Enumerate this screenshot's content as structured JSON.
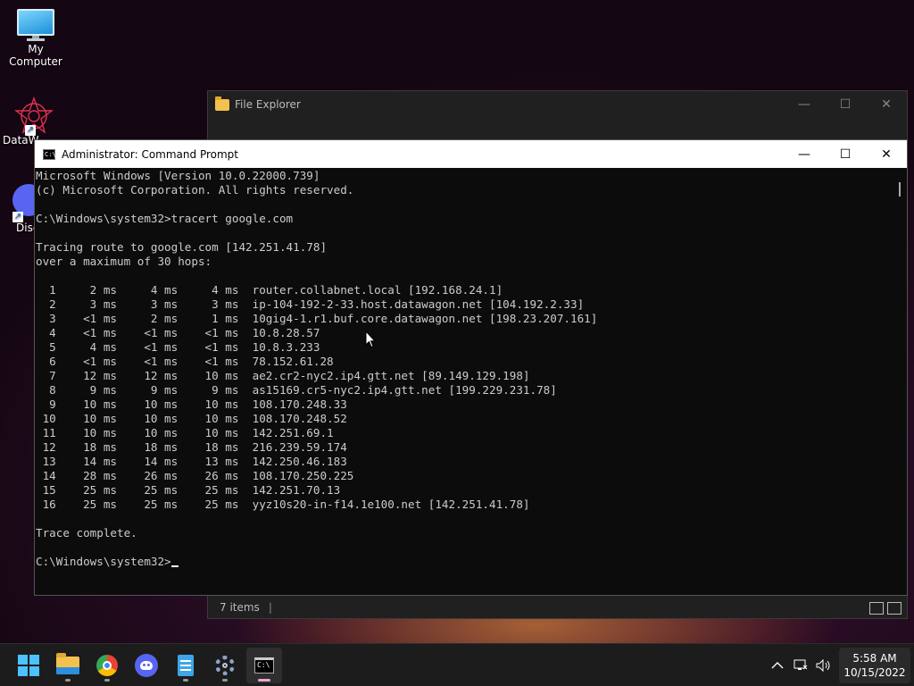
{
  "desktop": {
    "icons": [
      {
        "label": "My Computer"
      },
      {
        "label": "DataW"
      },
      {
        "label": "Disc"
      }
    ]
  },
  "explorer": {
    "title": "File Explorer",
    "status_items": "7 items",
    "status_sep": "|"
  },
  "cmd": {
    "title": "Administrator: Command Prompt",
    "lines": [
      "Microsoft Windows [Version 10.0.22000.739]",
      "(c) Microsoft Corporation. All rights reserved.",
      "",
      "C:\\Windows\\system32>tracert google.com",
      "",
      "Tracing route to google.com [142.251.41.78]",
      "over a maximum of 30 hops:",
      "",
      "  1     2 ms     4 ms     4 ms  router.collabnet.local [192.168.24.1]",
      "  2     3 ms     3 ms     3 ms  ip-104-192-2-33.host.datawagon.net [104.192.2.33]",
      "  3    <1 ms     2 ms     1 ms  10gig4-1.r1.buf.core.datawagon.net [198.23.207.161]",
      "  4    <1 ms    <1 ms    <1 ms  10.8.28.57",
      "  5     4 ms    <1 ms    <1 ms  10.8.3.233",
      "  6    <1 ms    <1 ms    <1 ms  78.152.61.28",
      "  7    12 ms    12 ms    10 ms  ae2.cr2-nyc2.ip4.gtt.net [89.149.129.198]",
      "  8     9 ms     9 ms     9 ms  as15169.cr5-nyc2.ip4.gtt.net [199.229.231.78]",
      "  9    10 ms    10 ms    10 ms  108.170.248.33",
      " 10    10 ms    10 ms    10 ms  108.170.248.52",
      " 11    10 ms    10 ms    10 ms  142.251.69.1",
      " 12    18 ms    18 ms    18 ms  216.239.59.174",
      " 13    14 ms    14 ms    13 ms  142.250.46.183",
      " 14    28 ms    26 ms    26 ms  108.170.250.225",
      " 15    25 ms    25 ms    25 ms  142.251.70.13",
      " 16    25 ms    25 ms    25 ms  yyz10s20-in-f14.1e100.net [142.251.41.78]",
      "",
      "Trace complete.",
      ""
    ],
    "prompt": "C:\\Windows\\system32>"
  },
  "taskbar": {
    "apps": [
      {
        "name": "start",
        "icon": "windows-logo-icon"
      },
      {
        "name": "file-explorer",
        "icon": "folder-icon"
      },
      {
        "name": "chrome",
        "icon": "chrome-icon"
      },
      {
        "name": "discord",
        "icon": "discord-icon"
      },
      {
        "name": "notepad",
        "icon": "notepad-icon"
      },
      {
        "name": "settings",
        "icon": "gear-icon"
      },
      {
        "name": "command-prompt",
        "icon": "terminal-icon"
      }
    ],
    "time": "5:58 AM",
    "date": "10/15/2022"
  },
  "colors": {
    "accent": "#4cc2ff",
    "console_bg": "#0c0c0c",
    "console_fg": "#cccccc"
  }
}
